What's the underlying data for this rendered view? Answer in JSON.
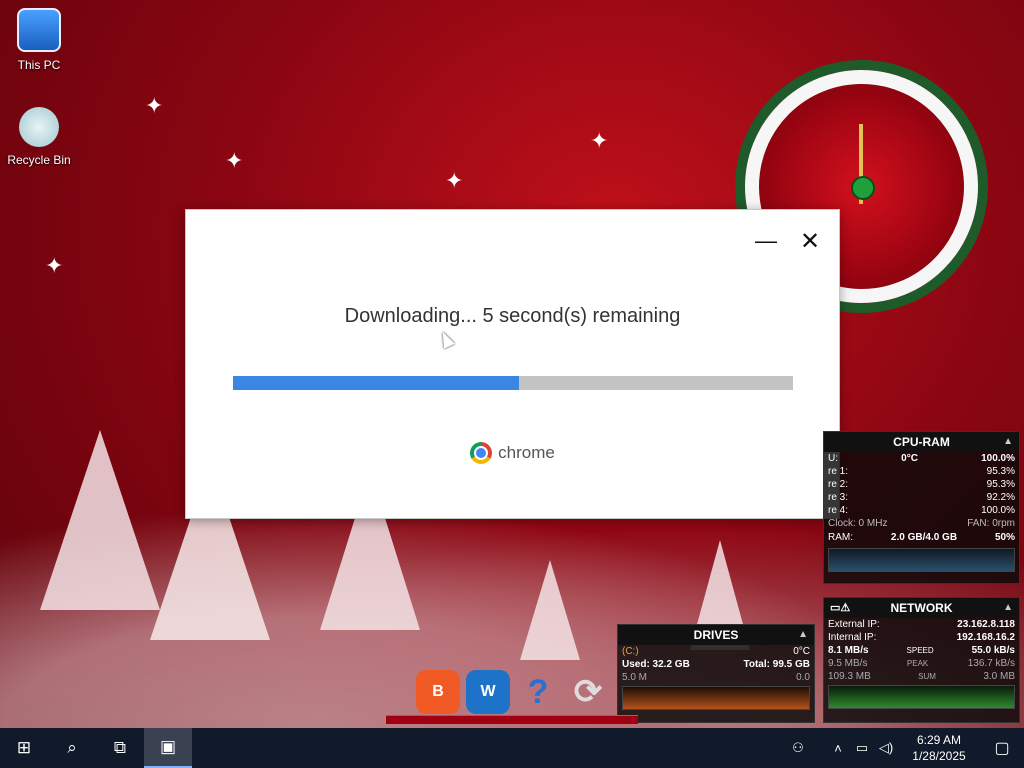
{
  "desktop": {
    "icons": [
      {
        "label": "This PC",
        "icon": "monitor-icon"
      },
      {
        "label": "Recycle Bin",
        "icon": "recycle-bin-icon"
      }
    ]
  },
  "dialog": {
    "status": "Downloading... 5 second(s) remaining",
    "progress": 0.51,
    "brand": "chrome",
    "minimize_symbol": "—",
    "close_symbol": "✕",
    "colors": {
      "progress_fill": "#3a86e2",
      "progress_track": "#c4c4c4"
    }
  },
  "gadgets": {
    "cpu": {
      "title": "CPU-RAM",
      "cpu_label": "U:",
      "cpu_temp": "0°C",
      "cpu_total": "100.0%",
      "cores": [
        {
          "label": "re 1:",
          "value": "95.3%"
        },
        {
          "label": "re 2:",
          "value": "95.3%"
        },
        {
          "label": "re 3:",
          "value": "92.2%"
        },
        {
          "label": "re 4:",
          "value": "100.0%"
        }
      ],
      "clock": "Clock: 0 MHz",
      "fan": "FAN: 0rpm",
      "ram_label": "RAM:",
      "ram_value": "2.0 GB/4.0 GB",
      "ram_pct": "50%"
    },
    "network": {
      "title": "NETWORK",
      "external_label": "External IP:",
      "external_ip": "23.162.8.118",
      "internal_label": "Internal IP:",
      "internal_ip": "192.168.16.2",
      "speed_left": "8.1 MB/s",
      "speed_label": "SPEED",
      "speed_right": "55.0 kB/s",
      "peak_left": "9.5 MB/s",
      "peak_label": "PEAK",
      "peak_right": "136.7 kB/s",
      "sum_left": "109.3 MB",
      "sum_label": "SUM",
      "sum_right": "3.0 MB"
    },
    "drives": {
      "title": "DRIVES",
      "drive_letter": "(C:)",
      "temp": "0°C",
      "used": "Used: 32.2 GB",
      "total": "Total: 99.5 GB",
      "read": "5.0 M",
      "write": "0.0"
    }
  },
  "dock": {
    "items": [
      {
        "label": "B",
        "icon": "brave-icon",
        "color": "#f15a24"
      },
      {
        "label": "W",
        "icon": "wise-care-icon",
        "color": "#1e73c8"
      },
      {
        "label": "?",
        "icon": "help-icon",
        "color": "#2a6fd6"
      },
      {
        "label": "⟳",
        "icon": "sync-icon",
        "color": "#dddddd"
      }
    ]
  },
  "taskbar": {
    "time": "6:29 AM",
    "date": "1/28/2025"
  }
}
